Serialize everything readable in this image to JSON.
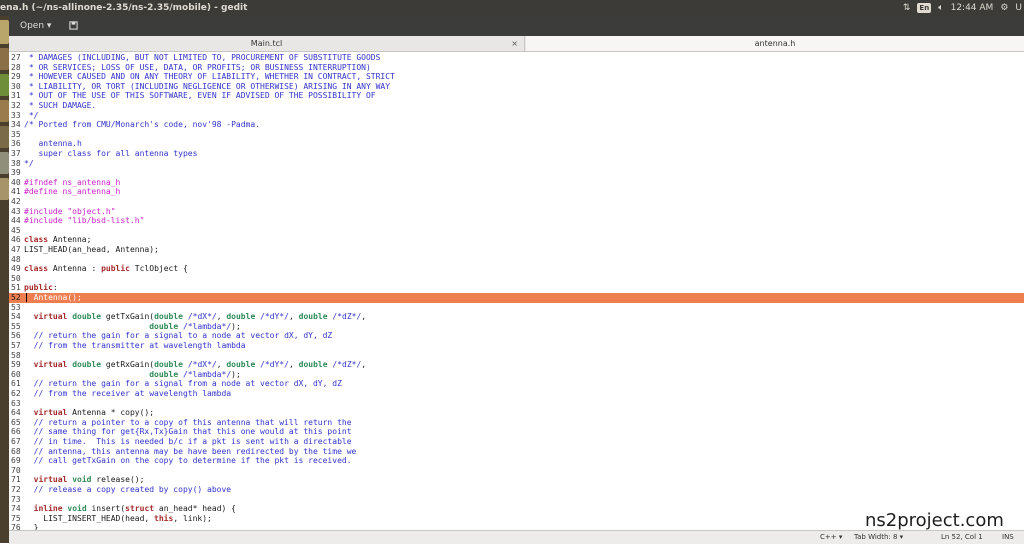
{
  "window": {
    "title": "ena.h (~/ns-allinone-2.35/ns-2.35/mobile) - gedit"
  },
  "tray": {
    "lang": "En",
    "time": "12:44 AM",
    "user": "U"
  },
  "toolbar": {
    "open_label": "Open ▾",
    "save_icon": "save-icon"
  },
  "tabs": [
    {
      "label": "Main.tcl",
      "close": "×"
    },
    {
      "label": "antenna.h"
    }
  ],
  "editor": {
    "current_line": 52,
    "lines": [
      {
        "n": "27",
        "segs": [
          {
            "c": "c",
            "t": " * DAMAGES (INCLUDING, BUT NOT LIMITED TO, PROCUREMENT OF SUBSTITUTE GOODS"
          }
        ]
      },
      {
        "n": "28",
        "segs": [
          {
            "c": "c",
            "t": " * OR SERVICES; LOSS OF USE, DATA, OR PROFITS; OR BUSINESS INTERRUPTION)"
          }
        ]
      },
      {
        "n": "29",
        "segs": [
          {
            "c": "c",
            "t": " * HOWEVER CAUSED AND ON ANY THEORY OF LIABILITY, WHETHER IN CONTRACT, STRICT"
          }
        ]
      },
      {
        "n": "30",
        "segs": [
          {
            "c": "c",
            "t": " * LIABILITY, OR TORT (INCLUDING NEGLIGENCE OR OTHERWISE) ARISING IN ANY WAY"
          }
        ]
      },
      {
        "n": "31",
        "segs": [
          {
            "c": "c",
            "t": " * OUT OF THE USE OF THIS SOFTWARE, EVEN IF ADVISED OF THE POSSIBILITY OF"
          }
        ]
      },
      {
        "n": "32",
        "segs": [
          {
            "c": "c",
            "t": " * SUCH DAMAGE."
          }
        ]
      },
      {
        "n": "33",
        "segs": [
          {
            "c": "c",
            "t": " */"
          }
        ]
      },
      {
        "n": "34",
        "segs": [
          {
            "c": "c",
            "t": "/* Ported from CMU/Monarch's code, nov'98 -Padma."
          }
        ]
      },
      {
        "n": "35",
        "segs": []
      },
      {
        "n": "36",
        "segs": [
          {
            "c": "c",
            "t": "   antenna.h"
          }
        ]
      },
      {
        "n": "37",
        "segs": [
          {
            "c": "c",
            "t": "   super class for all antenna types"
          }
        ]
      },
      {
        "n": "38",
        "segs": [
          {
            "c": "c",
            "t": "*/"
          }
        ]
      },
      {
        "n": "39",
        "segs": []
      },
      {
        "n": "40",
        "segs": [
          {
            "c": "pp",
            "t": "#ifndef ns_antenna_h"
          }
        ]
      },
      {
        "n": "41",
        "segs": [
          {
            "c": "pp",
            "t": "#define ns_antenna_h"
          }
        ]
      },
      {
        "n": "42",
        "segs": []
      },
      {
        "n": "43",
        "segs": [
          {
            "c": "pp",
            "t": "#include "
          },
          {
            "c": "s",
            "t": "\"object.h\""
          }
        ]
      },
      {
        "n": "44",
        "segs": [
          {
            "c": "pp",
            "t": "#include "
          },
          {
            "c": "s",
            "t": "\"lib/bsd-list.h\""
          }
        ]
      },
      {
        "n": "45",
        "segs": []
      },
      {
        "n": "46",
        "segs": [
          {
            "c": "k",
            "t": "class"
          },
          {
            "c": "tx",
            "t": " Antenna;"
          }
        ]
      },
      {
        "n": "47",
        "segs": [
          {
            "c": "tx",
            "t": "LIST_HEAD(an_head, Antenna);"
          }
        ]
      },
      {
        "n": "48",
        "segs": []
      },
      {
        "n": "49",
        "segs": [
          {
            "c": "k",
            "t": "class"
          },
          {
            "c": "tx",
            "t": " Antenna : "
          },
          {
            "c": "k",
            "t": "public"
          },
          {
            "c": "tx",
            "t": " TclObject {"
          }
        ]
      },
      {
        "n": "50",
        "segs": []
      },
      {
        "n": "51",
        "segs": [
          {
            "c": "k",
            "t": "public"
          },
          {
            "c": "tx",
            "t": ":"
          }
        ]
      },
      {
        "n": "52",
        "segs": [
          {
            "c": "tx",
            "t": "  Antenna();"
          }
        ]
      },
      {
        "n": "53",
        "segs": []
      },
      {
        "n": "54",
        "segs": [
          {
            "c": "tx",
            "t": "  "
          },
          {
            "c": "k",
            "t": "virtual"
          },
          {
            "c": "tx",
            "t": " "
          },
          {
            "c": "t",
            "t": "double"
          },
          {
            "c": "tx",
            "t": " getTxGain("
          },
          {
            "c": "t",
            "t": "double"
          },
          {
            "c": "tx",
            "t": " "
          },
          {
            "c": "c",
            "t": "/*dX*/"
          },
          {
            "c": "tx",
            "t": ", "
          },
          {
            "c": "t",
            "t": "double"
          },
          {
            "c": "tx",
            "t": " "
          },
          {
            "c": "c",
            "t": "/*dY*/"
          },
          {
            "c": "tx",
            "t": ", "
          },
          {
            "c": "t",
            "t": "double"
          },
          {
            "c": "tx",
            "t": " "
          },
          {
            "c": "c",
            "t": "/*dZ*/"
          },
          {
            "c": "tx",
            "t": ","
          }
        ]
      },
      {
        "n": "55",
        "segs": [
          {
            "c": "tx",
            "t": "                          "
          },
          {
            "c": "t",
            "t": "double"
          },
          {
            "c": "tx",
            "t": " "
          },
          {
            "c": "c",
            "t": "/*lambda*/"
          },
          {
            "c": "tx",
            "t": ");"
          }
        ]
      },
      {
        "n": "56",
        "segs": [
          {
            "c": "c",
            "t": "  // return the gain for a signal to a node at vector dX, dY, dZ"
          }
        ]
      },
      {
        "n": "57",
        "segs": [
          {
            "c": "c",
            "t": "  // from the transmitter at wavelength lambda"
          }
        ]
      },
      {
        "n": "58",
        "segs": []
      },
      {
        "n": "59",
        "segs": [
          {
            "c": "tx",
            "t": "  "
          },
          {
            "c": "k",
            "t": "virtual"
          },
          {
            "c": "tx",
            "t": " "
          },
          {
            "c": "t",
            "t": "double"
          },
          {
            "c": "tx",
            "t": " getRxGain("
          },
          {
            "c": "t",
            "t": "double"
          },
          {
            "c": "tx",
            "t": " "
          },
          {
            "c": "c",
            "t": "/*dX*/"
          },
          {
            "c": "tx",
            "t": ", "
          },
          {
            "c": "t",
            "t": "double"
          },
          {
            "c": "tx",
            "t": " "
          },
          {
            "c": "c",
            "t": "/*dY*/"
          },
          {
            "c": "tx",
            "t": ", "
          },
          {
            "c": "t",
            "t": "double"
          },
          {
            "c": "tx",
            "t": " "
          },
          {
            "c": "c",
            "t": "/*dZ*/"
          },
          {
            "c": "tx",
            "t": ","
          }
        ]
      },
      {
        "n": "60",
        "segs": [
          {
            "c": "tx",
            "t": "                          "
          },
          {
            "c": "t",
            "t": "double"
          },
          {
            "c": "tx",
            "t": " "
          },
          {
            "c": "c",
            "t": "/*lambda*/"
          },
          {
            "c": "tx",
            "t": ");"
          }
        ]
      },
      {
        "n": "61",
        "segs": [
          {
            "c": "c",
            "t": "  // return the gain for a signal from a node at vector dX, dY, dZ"
          }
        ]
      },
      {
        "n": "62",
        "segs": [
          {
            "c": "c",
            "t": "  // from the receiver at wavelength lambda"
          }
        ]
      },
      {
        "n": "63",
        "segs": []
      },
      {
        "n": "64",
        "segs": [
          {
            "c": "tx",
            "t": "  "
          },
          {
            "c": "k",
            "t": "virtual"
          },
          {
            "c": "tx",
            "t": " Antenna * copy();"
          }
        ]
      },
      {
        "n": "65",
        "segs": [
          {
            "c": "c",
            "t": "  // return a pointer to a copy of this antenna that will return the"
          }
        ]
      },
      {
        "n": "66",
        "segs": [
          {
            "c": "c",
            "t": "  // same thing for get{Rx,Tx}Gain that this one would at this point"
          }
        ]
      },
      {
        "n": "67",
        "segs": [
          {
            "c": "c",
            "t": "  // in time.  This is needed b/c if a pkt is sent with a directable"
          }
        ]
      },
      {
        "n": "68",
        "segs": [
          {
            "c": "c",
            "t": "  // antenna, this antenna may be have been redirected by the time we"
          }
        ]
      },
      {
        "n": "69",
        "segs": [
          {
            "c": "c",
            "t": "  // call getTxGain on the copy to determine if the pkt is received."
          }
        ]
      },
      {
        "n": "70",
        "segs": []
      },
      {
        "n": "71",
        "segs": [
          {
            "c": "tx",
            "t": "  "
          },
          {
            "c": "k",
            "t": "virtual"
          },
          {
            "c": "tx",
            "t": " "
          },
          {
            "c": "t",
            "t": "void"
          },
          {
            "c": "tx",
            "t": " release();"
          }
        ]
      },
      {
        "n": "72",
        "segs": [
          {
            "c": "c",
            "t": "  // release a copy created by copy() above"
          }
        ]
      },
      {
        "n": "73",
        "segs": []
      },
      {
        "n": "74",
        "segs": [
          {
            "c": "tx",
            "t": "  "
          },
          {
            "c": "k",
            "t": "inline"
          },
          {
            "c": "tx",
            "t": " "
          },
          {
            "c": "t",
            "t": "void"
          },
          {
            "c": "tx",
            "t": " insert("
          },
          {
            "c": "k",
            "t": "struct"
          },
          {
            "c": "tx",
            "t": " an_head* head) {"
          }
        ]
      },
      {
        "n": "75",
        "segs": [
          {
            "c": "tx",
            "t": "    LIST_INSERT_HEAD(head, "
          },
          {
            "c": "k",
            "t": "this"
          },
          {
            "c": "tx",
            "t": ", link);"
          }
        ]
      },
      {
        "n": "76",
        "segs": [
          {
            "c": "tx",
            "t": "  }"
          }
        ]
      }
    ]
  },
  "statusbar": {
    "language": "C++ ▾",
    "tab_width": "Tab Width: 8 ▾",
    "position": "Ln 52, Col 1",
    "insert_mode": "INS"
  },
  "watermark": "ns2project.com",
  "colors": {
    "current_line": "#ee7e50",
    "comment": "#3333cc",
    "preprocessor": "#cc22cc",
    "keyword": "#a52a2a",
    "type": "#2e8b57"
  }
}
